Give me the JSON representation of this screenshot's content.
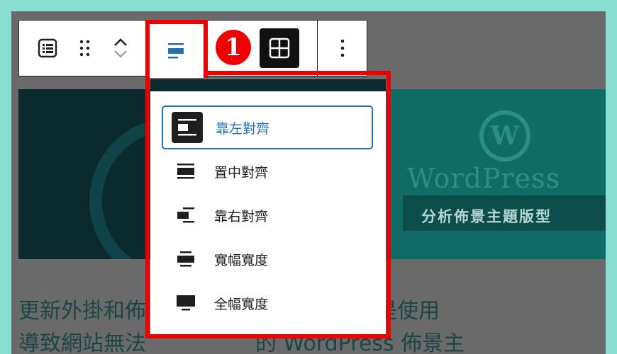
{
  "toolbar": {
    "buttons": [
      "list-view",
      "drag-handle",
      "move-up-down",
      "align",
      "grid",
      "options"
    ]
  },
  "badge": {
    "number": "1"
  },
  "align_menu": {
    "items": [
      {
        "label": "靠左對齊",
        "selected": true
      },
      {
        "label": "置中對齊",
        "selected": false
      },
      {
        "label": "靠右對齊",
        "selected": false
      },
      {
        "label": "寬幅寬度",
        "selected": false
      },
      {
        "label": "全幅寬度",
        "selected": false
      }
    ]
  },
  "hero": {
    "logo_glyph": "W",
    "wordmark": "WordPress",
    "subtitle": "分析佈景主題版型"
  },
  "content": {
    "line1_left": "更新外掛和佈",
    "line1_right": "找出心儀網站是使用",
    "line2_left": "導致網站無法",
    "line2_right": "的 WordPress 佈景主"
  },
  "colors": {
    "highlight": "#ee0000",
    "accent": "#2271b1",
    "frame": "#8adfd2"
  }
}
